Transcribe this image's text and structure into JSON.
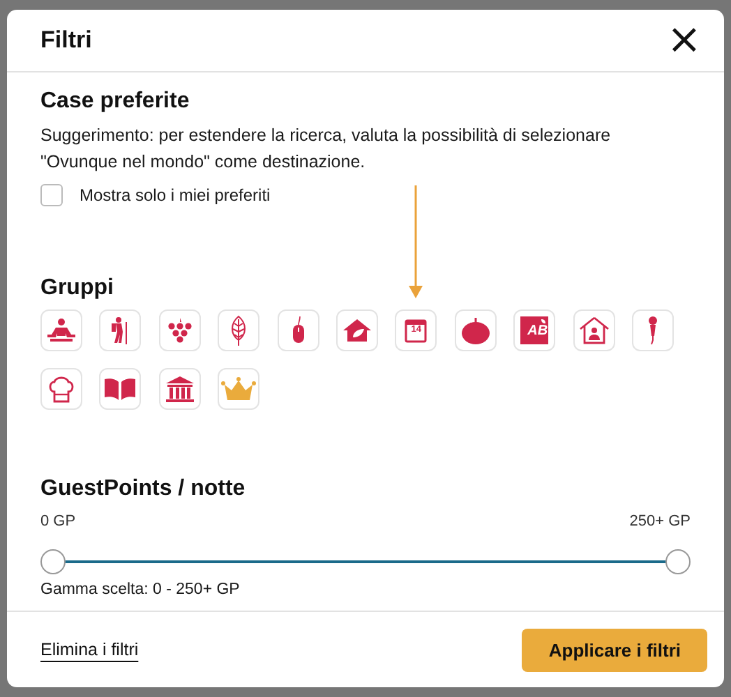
{
  "dialog": {
    "title": "Filtri",
    "close": "×"
  },
  "favorites": {
    "heading": "Case preferite",
    "hint": "Suggerimento: per estendere la ricerca, valuta la possibilità di selezionare \"Ovunque nel mondo\" come destinazione.",
    "checkbox": {
      "label": "Mostra solo i miei preferiti",
      "checked": false
    }
  },
  "groups": {
    "heading": "Gruppi",
    "items": [
      {
        "kind": "meditation"
      },
      {
        "kind": "hiker"
      },
      {
        "kind": "grapes"
      },
      {
        "kind": "leaf"
      },
      {
        "kind": "mouse"
      },
      {
        "kind": "house-leaf"
      },
      {
        "kind": "calendar",
        "label": "14"
      },
      {
        "kind": "tomato"
      },
      {
        "kind": "organic",
        "label": "AB"
      },
      {
        "kind": "house-person"
      },
      {
        "kind": "microphone"
      },
      {
        "kind": "chef-hat"
      },
      {
        "kind": "book"
      },
      {
        "kind": "museum"
      },
      {
        "kind": "crown"
      }
    ]
  },
  "guestpoints": {
    "heading": "GuestPoints / notte",
    "min_label": "0 GP",
    "max_label": "250+ GP",
    "thumbs": [
      {
        "level": 0
      },
      {
        "level": 1
      }
    ],
    "range_text": "Gamma scelta: 0 - 250+ GP"
  },
  "footer": {
    "clear": "Elimina i filtri",
    "apply": "Applicare i filtri"
  }
}
